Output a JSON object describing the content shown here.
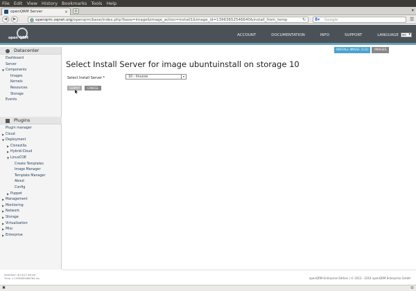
{
  "browser": {
    "menu": [
      "File",
      "Edit",
      "View",
      "History",
      "Bookmarks",
      "Tools",
      "Help"
    ],
    "tab_title": "openQRM Server",
    "url_host": "openqrm.oqnet.org",
    "url_rest": "/openqrm/base/index.php?base=image&image_action=install1&image_id=13963652546640&install_from_temp",
    "search_placeholder": "Google"
  },
  "header": {
    "logo_text": "open QRM",
    "nav": [
      "ACCOUNT",
      "DOCUMENTATION",
      "INFO",
      "SUPPORT"
    ],
    "language_label": "LANGUAGE",
    "language_value": "en"
  },
  "sidebar": {
    "datacenter_title": "Datacenter",
    "datacenter_items": [
      "Dashboard",
      "Server",
      "Components",
      "Images",
      "Kernels",
      "Resources",
      "Storage",
      "Events"
    ],
    "plugins_title": "Plugins",
    "plugin_items": [
      "Plugin manager",
      "Cloud",
      "Deployment",
      "Clonezilla",
      "Hybrid-Cloud",
      "LinuxCOE",
      "Create Templates",
      "Image Manager",
      "Template Manager",
      "About",
      "Config",
      "Puppet",
      "Management",
      "Monitoring",
      "Network",
      "Storage",
      "Virtualization",
      "Misc",
      "Enterprise"
    ],
    "status_line1": "Selection: 4|15|12 Server",
    "status_line2": "Time: 1:1396365466764 ms"
  },
  "main": {
    "btn_install_image": "INSTALL IMAGE (1/2)",
    "btn_images": "IMAGES",
    "title": "Select Install Server for image ubuntuinstall on storage 10",
    "field_label": "Select Install Server *",
    "select_value": "10 - linucoe",
    "submit": "SUBMIT",
    "cancel": "CANCEL"
  },
  "footer": {
    "text": "openQRM Enterprise Edition | © 2012 - 2014 openQRM Enterprise GmbH"
  },
  "colors": {
    "header_bg": "#4a5258",
    "accent": "#4aa3d1"
  }
}
